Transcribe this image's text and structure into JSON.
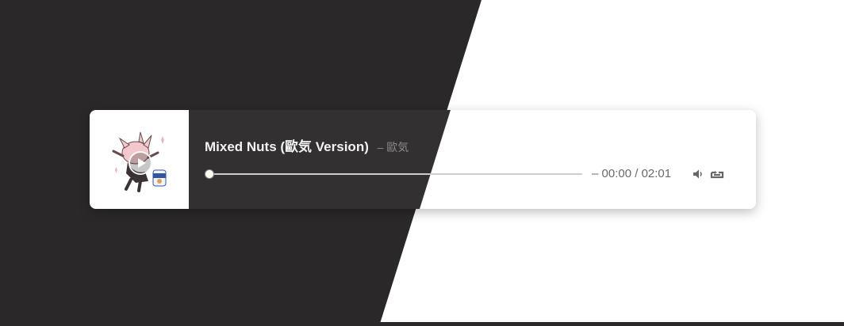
{
  "player": {
    "title": "Mixed Nuts (歐気 Version)",
    "artist": "– 歐気",
    "time_current": "00:00",
    "time_total": "02:01",
    "time_dash": "–",
    "time_separator": "/",
    "progress": 0.0,
    "accent_color": "#fffdf3"
  },
  "icons": {
    "play": "play-icon",
    "volume": "volume-icon",
    "loop": "loop-icon"
  },
  "colors": {
    "dark_background": "#2b2829",
    "card_dark": "#333031",
    "card_light": "#ffffff"
  }
}
